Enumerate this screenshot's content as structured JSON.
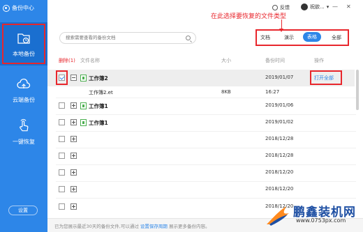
{
  "app": {
    "title": "备份中心"
  },
  "sidebar": {
    "items": [
      {
        "label": "本地备份",
        "icon": "folder-clock-icon"
      },
      {
        "label": "云端备份",
        "icon": "cloud-upload-icon"
      },
      {
        "label": "一键恢复",
        "icon": "hand-pointer-icon"
      }
    ],
    "settings_label": "设置"
  },
  "topbar": {
    "feedback_label": "反馈",
    "user_name": "祝欲...",
    "dropdown": "▾",
    "minimize": "—",
    "close": "✕"
  },
  "annotation": {
    "text": "在此选择要恢复的文件类型"
  },
  "search": {
    "placeholder": "搜索需要查看的备份文档"
  },
  "filters": {
    "tabs": [
      "文档",
      "演示",
      "表格",
      "全部"
    ],
    "active": "表格"
  },
  "table": {
    "headers": {
      "delete": "删除(1)",
      "name": "文件名称",
      "size": "大小",
      "time": "备份时间",
      "action": "操作"
    },
    "rows": [
      {
        "name": "工作簿2",
        "date": "2019/01/07",
        "action": "打开全部"
      },
      {
        "name": "工作簿2.et",
        "size": "8KB",
        "date": "16:27"
      },
      {
        "name": "工作簿1",
        "date": "2019/01/06"
      },
      {
        "name": "工作簿1",
        "date": "2019/01/02"
      },
      {
        "name": "",
        "date": "2018/12/28"
      },
      {
        "name": "",
        "date": "2018/12/28"
      },
      {
        "name": "",
        "date": "2018/12/20"
      },
      {
        "name": "",
        "date": "2018/12/20"
      },
      {
        "name": "",
        "date": "2018/12/20"
      }
    ]
  },
  "footer": {
    "text_before": "已为您展示最近30天的备份文件,可以通过",
    "link": "设置保存周期",
    "text_after": "展示更多备份内容。"
  },
  "watermark": {
    "title": "鹏鑫装机网",
    "url": "www.0753px.com"
  },
  "colors": {
    "accent": "#2d86e8",
    "annotation": "#e8262c",
    "sidebar_active": "#1a6fd0"
  }
}
